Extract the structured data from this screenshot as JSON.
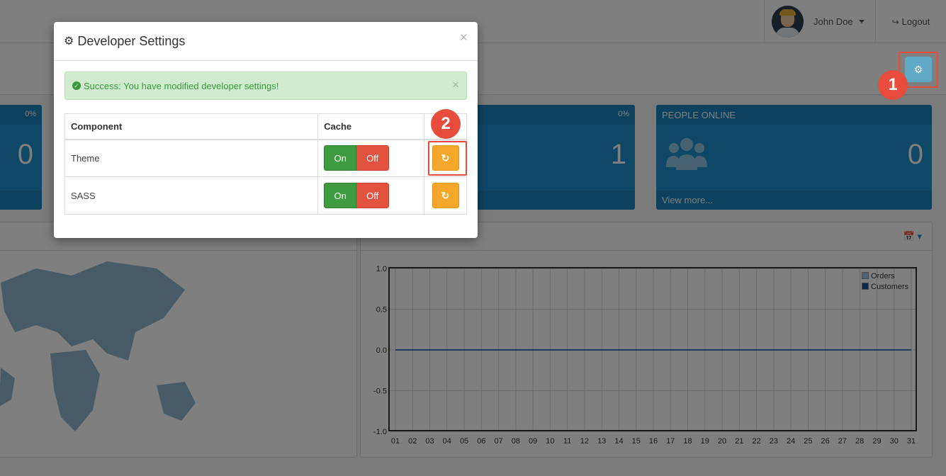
{
  "topbar": {
    "user_name": "John Doe",
    "logout_label": "Logout"
  },
  "tiles": [
    {
      "percent": "0%",
      "value": "0"
    },
    {
      "percent": "0%",
      "value": "1"
    },
    {
      "title": "PEOPLE ONLINE",
      "value": "0",
      "footer": "View more..."
    }
  ],
  "chart_data": {
    "type": "line",
    "x": [
      "01",
      "02",
      "03",
      "04",
      "05",
      "06",
      "07",
      "08",
      "09",
      "10",
      "11",
      "12",
      "13",
      "14",
      "15",
      "16",
      "17",
      "18",
      "19",
      "20",
      "21",
      "22",
      "23",
      "24",
      "25",
      "26",
      "27",
      "28",
      "29",
      "30",
      "31"
    ],
    "yticks": [
      "1.0",
      "0.5",
      "0.0",
      "-0.5",
      "-1.0"
    ],
    "ylim": [
      -1.0,
      1.0
    ],
    "grid": true,
    "legend_position": "top-right",
    "series": [
      {
        "name": "Orders",
        "color": "#9ec5e2",
        "values": [
          0,
          0,
          0,
          0,
          0,
          0,
          0,
          0,
          0,
          0,
          0,
          0,
          0,
          0,
          0,
          0,
          0,
          0,
          0,
          0,
          0,
          0,
          0,
          0,
          0,
          0,
          0,
          0,
          0,
          0,
          0
        ]
      },
      {
        "name": "Customers",
        "color": "#1a4f9c",
        "values": [
          0,
          0,
          0,
          0,
          0,
          0,
          0,
          0,
          0,
          0,
          0,
          0,
          0,
          0,
          0,
          0,
          0,
          0,
          0,
          0,
          0,
          0,
          0,
          0,
          0,
          0,
          0,
          0,
          0,
          0,
          0
        ]
      }
    ]
  },
  "modal": {
    "title": "Developer Settings",
    "close_symbol": "×",
    "alert_text": "Success: You have modified developer settings!",
    "alert_close_symbol": "×",
    "table": {
      "headers": {
        "component": "Component",
        "cache": "Cache"
      },
      "rows": [
        {
          "component": "Theme",
          "on_label": "On",
          "off_label": "Off"
        },
        {
          "component": "SASS",
          "on_label": "On",
          "off_label": "Off"
        }
      ]
    }
  },
  "annotations": {
    "marker_1": "1",
    "marker_2": "2"
  },
  "colors": {
    "primary": "#1e91cf",
    "success": "#3f9b3f",
    "danger": "#e2533f",
    "warning": "#f4a72a",
    "annotation": "#e74c3c"
  },
  "icons": [
    "gear-icon",
    "logout-icon",
    "refresh-icon",
    "check-circle-icon",
    "calendar-icon",
    "users-icon",
    "caret-down-icon"
  ]
}
